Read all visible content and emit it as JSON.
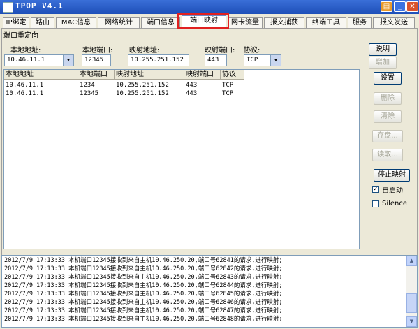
{
  "window": {
    "title": "TPOP V4.1"
  },
  "tabs": [
    {
      "label": "IP绑定"
    },
    {
      "label": "路由"
    },
    {
      "label": "MAC信息"
    },
    {
      "label": "网络统计"
    },
    {
      "label": "端口信息"
    },
    {
      "label": "端口映射"
    },
    {
      "label": "网卡流量"
    },
    {
      "label": "报文捕获"
    },
    {
      "label": "终端工具"
    },
    {
      "label": "服务"
    },
    {
      "label": "报文发送"
    }
  ],
  "active_tab": "端口映射",
  "group": {
    "title": "端口重定向"
  },
  "form": {
    "local_addr_label": "本地地址:",
    "local_addr_value": "10.46.11.1",
    "local_port_label": "本地端口:",
    "local_port_value": "12345",
    "map_addr_label": "映射地址:",
    "map_addr_value": "10.255.251.152",
    "map_port_label": "映射端口:",
    "map_port_value": "443",
    "protocol_label": "协议:",
    "protocol_value": "TCP"
  },
  "buttons": {
    "explain": "说明",
    "add": "增加",
    "settings": "设置",
    "delete": "删除",
    "sort": "清除",
    "save": "存盘...",
    "load": "读取...",
    "stop": "停止映射"
  },
  "checkboxes": {
    "autostart": {
      "label": "自启动",
      "checked": true
    },
    "silence": {
      "label": "Silence",
      "checked": false
    }
  },
  "table": {
    "headers": [
      "本地地址",
      "本地端口",
      "映射地址",
      "映射端口",
      "协议"
    ],
    "rows": [
      [
        "10.46.11.1",
        "1234",
        "10.255.251.152",
        "443",
        "TCP"
      ],
      [
        "10.46.11.1",
        "12345",
        "10.255.251.152",
        "443",
        "TCP"
      ]
    ]
  },
  "log": [
    "2012/7/9 17:13:33 本机端口12345接收到来自主机10.46.250.20,端口号62841的请求,进行映射;",
    "2012/7/9 17:13:33 本机端口12345接收到来自主机10.46.250.20,端口号62842的请求,进行映射;",
    "2012/7/9 17:13:33 本机端口12345接收到来自主机10.46.250.20,端口号62843的请求,进行映射;",
    "2012/7/9 17:13:33 本机端口12345接收到来自主机10.46.250.20,端口号62844的请求,进行映射;",
    "2012/7/9 17:13:33 本机端口12345接收到来自主机10.46.250.20,端口号62845的请求,进行映射;",
    "2012/7/9 17:13:33 本机端口12345接收到来自主机10.46.250.20,端口号62846的请求,进行映射;",
    "2012/7/9 17:13:33 本机端口12345接收到来自主机10.46.250.20,端口号62847的请求,进行映射;",
    "2012/7/9 17:13:33 本机端口12345接收到来自主机10.46.250.20,端口号62848的请求,进行映射;"
  ],
  "colors": {
    "titlebar": "#1e4fb8",
    "highlight": "#e02020",
    "panel": "#ece9d8"
  }
}
